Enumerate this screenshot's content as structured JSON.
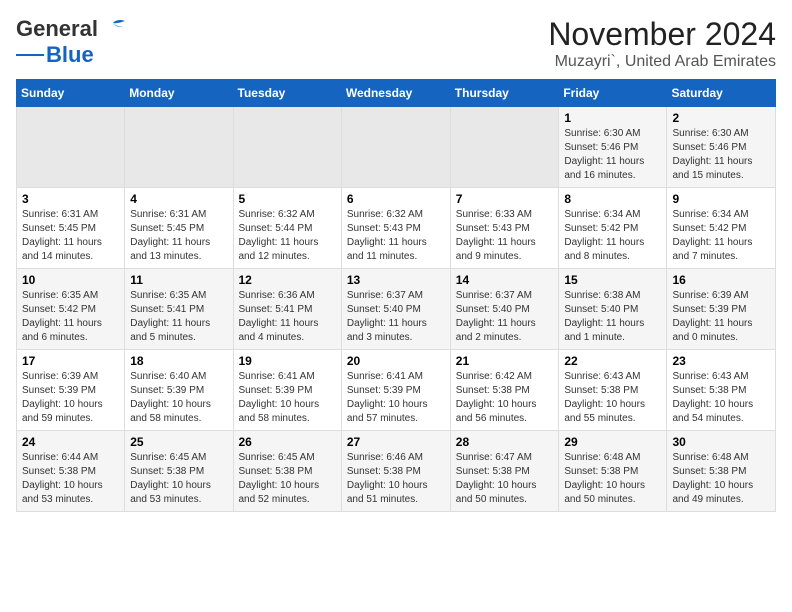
{
  "header": {
    "logo_general": "General",
    "logo_blue": "Blue",
    "month_title": "November 2024",
    "location": "Muzayri`, United Arab Emirates"
  },
  "weekdays": [
    "Sunday",
    "Monday",
    "Tuesday",
    "Wednesday",
    "Thursday",
    "Friday",
    "Saturday"
  ],
  "weeks": [
    [
      {
        "day": "",
        "info": ""
      },
      {
        "day": "",
        "info": ""
      },
      {
        "day": "",
        "info": ""
      },
      {
        "day": "",
        "info": ""
      },
      {
        "day": "",
        "info": ""
      },
      {
        "day": "1",
        "info": "Sunrise: 6:30 AM\nSunset: 5:46 PM\nDaylight: 11 hours and 16 minutes."
      },
      {
        "day": "2",
        "info": "Sunrise: 6:30 AM\nSunset: 5:46 PM\nDaylight: 11 hours and 15 minutes."
      }
    ],
    [
      {
        "day": "3",
        "info": "Sunrise: 6:31 AM\nSunset: 5:45 PM\nDaylight: 11 hours and 14 minutes."
      },
      {
        "day": "4",
        "info": "Sunrise: 6:31 AM\nSunset: 5:45 PM\nDaylight: 11 hours and 13 minutes."
      },
      {
        "day": "5",
        "info": "Sunrise: 6:32 AM\nSunset: 5:44 PM\nDaylight: 11 hours and 12 minutes."
      },
      {
        "day": "6",
        "info": "Sunrise: 6:32 AM\nSunset: 5:43 PM\nDaylight: 11 hours and 11 minutes."
      },
      {
        "day": "7",
        "info": "Sunrise: 6:33 AM\nSunset: 5:43 PM\nDaylight: 11 hours and 9 minutes."
      },
      {
        "day": "8",
        "info": "Sunrise: 6:34 AM\nSunset: 5:42 PM\nDaylight: 11 hours and 8 minutes."
      },
      {
        "day": "9",
        "info": "Sunrise: 6:34 AM\nSunset: 5:42 PM\nDaylight: 11 hours and 7 minutes."
      }
    ],
    [
      {
        "day": "10",
        "info": "Sunrise: 6:35 AM\nSunset: 5:42 PM\nDaylight: 11 hours and 6 minutes."
      },
      {
        "day": "11",
        "info": "Sunrise: 6:35 AM\nSunset: 5:41 PM\nDaylight: 11 hours and 5 minutes."
      },
      {
        "day": "12",
        "info": "Sunrise: 6:36 AM\nSunset: 5:41 PM\nDaylight: 11 hours and 4 minutes."
      },
      {
        "day": "13",
        "info": "Sunrise: 6:37 AM\nSunset: 5:40 PM\nDaylight: 11 hours and 3 minutes."
      },
      {
        "day": "14",
        "info": "Sunrise: 6:37 AM\nSunset: 5:40 PM\nDaylight: 11 hours and 2 minutes."
      },
      {
        "day": "15",
        "info": "Sunrise: 6:38 AM\nSunset: 5:40 PM\nDaylight: 11 hours and 1 minute."
      },
      {
        "day": "16",
        "info": "Sunrise: 6:39 AM\nSunset: 5:39 PM\nDaylight: 11 hours and 0 minutes."
      }
    ],
    [
      {
        "day": "17",
        "info": "Sunrise: 6:39 AM\nSunset: 5:39 PM\nDaylight: 10 hours and 59 minutes."
      },
      {
        "day": "18",
        "info": "Sunrise: 6:40 AM\nSunset: 5:39 PM\nDaylight: 10 hours and 58 minutes."
      },
      {
        "day": "19",
        "info": "Sunrise: 6:41 AM\nSunset: 5:39 PM\nDaylight: 10 hours and 58 minutes."
      },
      {
        "day": "20",
        "info": "Sunrise: 6:41 AM\nSunset: 5:39 PM\nDaylight: 10 hours and 57 minutes."
      },
      {
        "day": "21",
        "info": "Sunrise: 6:42 AM\nSunset: 5:38 PM\nDaylight: 10 hours and 56 minutes."
      },
      {
        "day": "22",
        "info": "Sunrise: 6:43 AM\nSunset: 5:38 PM\nDaylight: 10 hours and 55 minutes."
      },
      {
        "day": "23",
        "info": "Sunrise: 6:43 AM\nSunset: 5:38 PM\nDaylight: 10 hours and 54 minutes."
      }
    ],
    [
      {
        "day": "24",
        "info": "Sunrise: 6:44 AM\nSunset: 5:38 PM\nDaylight: 10 hours and 53 minutes."
      },
      {
        "day": "25",
        "info": "Sunrise: 6:45 AM\nSunset: 5:38 PM\nDaylight: 10 hours and 53 minutes."
      },
      {
        "day": "26",
        "info": "Sunrise: 6:45 AM\nSunset: 5:38 PM\nDaylight: 10 hours and 52 minutes."
      },
      {
        "day": "27",
        "info": "Sunrise: 6:46 AM\nSunset: 5:38 PM\nDaylight: 10 hours and 51 minutes."
      },
      {
        "day": "28",
        "info": "Sunrise: 6:47 AM\nSunset: 5:38 PM\nDaylight: 10 hours and 50 minutes."
      },
      {
        "day": "29",
        "info": "Sunrise: 6:48 AM\nSunset: 5:38 PM\nDaylight: 10 hours and 50 minutes."
      },
      {
        "day": "30",
        "info": "Sunrise: 6:48 AM\nSunset: 5:38 PM\nDaylight: 10 hours and 49 minutes."
      }
    ]
  ]
}
